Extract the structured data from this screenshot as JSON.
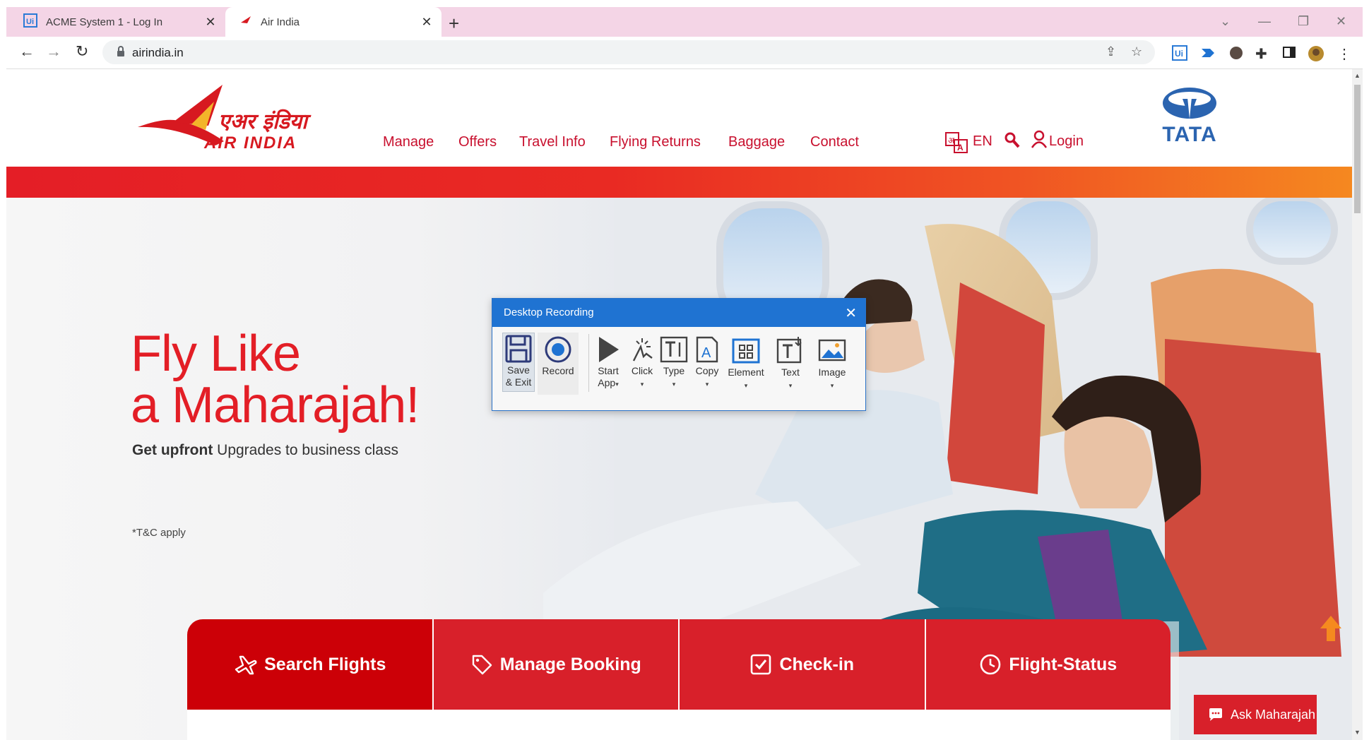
{
  "browser": {
    "tabs": [
      {
        "title": "ACME System 1 - Log In",
        "icon": "uipath-icon"
      },
      {
        "title": "Air India",
        "icon": "air-india-icon"
      }
    ],
    "url": "airindia.in"
  },
  "site": {
    "nav": [
      "Manage",
      "Offers",
      "Travel Info",
      "Flying Returns",
      "Baggage",
      "Contact"
    ],
    "language": "EN",
    "login": "Login",
    "tata": "TATA",
    "hero": {
      "line1": "Fly Like",
      "line2": "a Maharajah!",
      "sub_bold": "Get upfront",
      "sub_rest": "Upgrades to business class",
      "tnc": "*T&C apply"
    },
    "booking_tabs": [
      "Search Flights",
      "Manage Booking",
      "Check-in",
      "Flight-Status"
    ],
    "chat": "Ask Maharajah"
  },
  "recorder": {
    "title": "Desktop Recording",
    "buttons": {
      "save_1": "Save",
      "save_2": "& Exit",
      "record": "Record",
      "start_1": "Start",
      "start_2": "App",
      "click": "Click",
      "type": "Type",
      "copy": "Copy",
      "element": "Element",
      "text": "Text",
      "image": "Image"
    }
  },
  "colors": {
    "brand_red": "#e31e26",
    "tab_strip": "#f4d5e6",
    "recorder_blue": "#1f73d2"
  }
}
